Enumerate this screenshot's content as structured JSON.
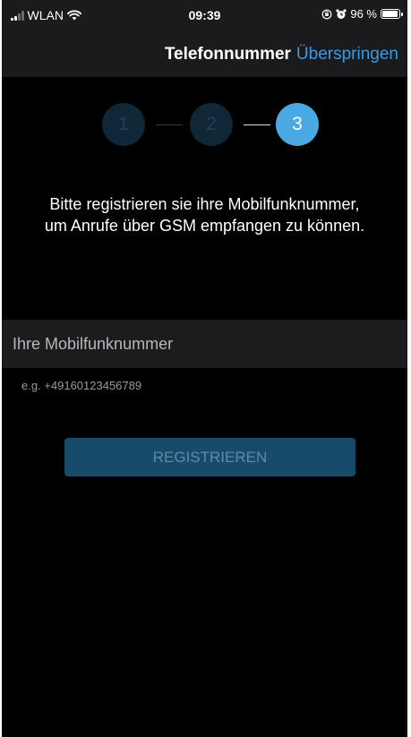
{
  "status_bar": {
    "carrier": "WLAN",
    "time": "09:39",
    "battery_percent": "96 %",
    "battery_level": 0.96,
    "icons": [
      "signal-icon",
      "wifi-icon",
      "orientation-lock-icon",
      "alarm-icon",
      "battery-icon"
    ]
  },
  "nav": {
    "title": "Telefonnummer",
    "skip_label": "Überspringen"
  },
  "stepper": {
    "steps": [
      "1",
      "2",
      "3"
    ],
    "current": 3
  },
  "instruction": "Bitte registrieren sie ihre Mobilfunknummer, um Anrufe über GSM empfangen zu können.",
  "phone_field": {
    "placeholder": "Ihre Mobilfunknummer",
    "value": "",
    "hint": "e.g. +49160123456789"
  },
  "register_button": {
    "label": "REGISTRIEREN",
    "enabled": false
  },
  "colors": {
    "accent": "#3a99e6",
    "step_active": "#4aa9e3",
    "step_inactive": "#0f2737",
    "button_disabled": "#174b6a",
    "background": "#000000",
    "bar_background": "#1b1b1d"
  }
}
